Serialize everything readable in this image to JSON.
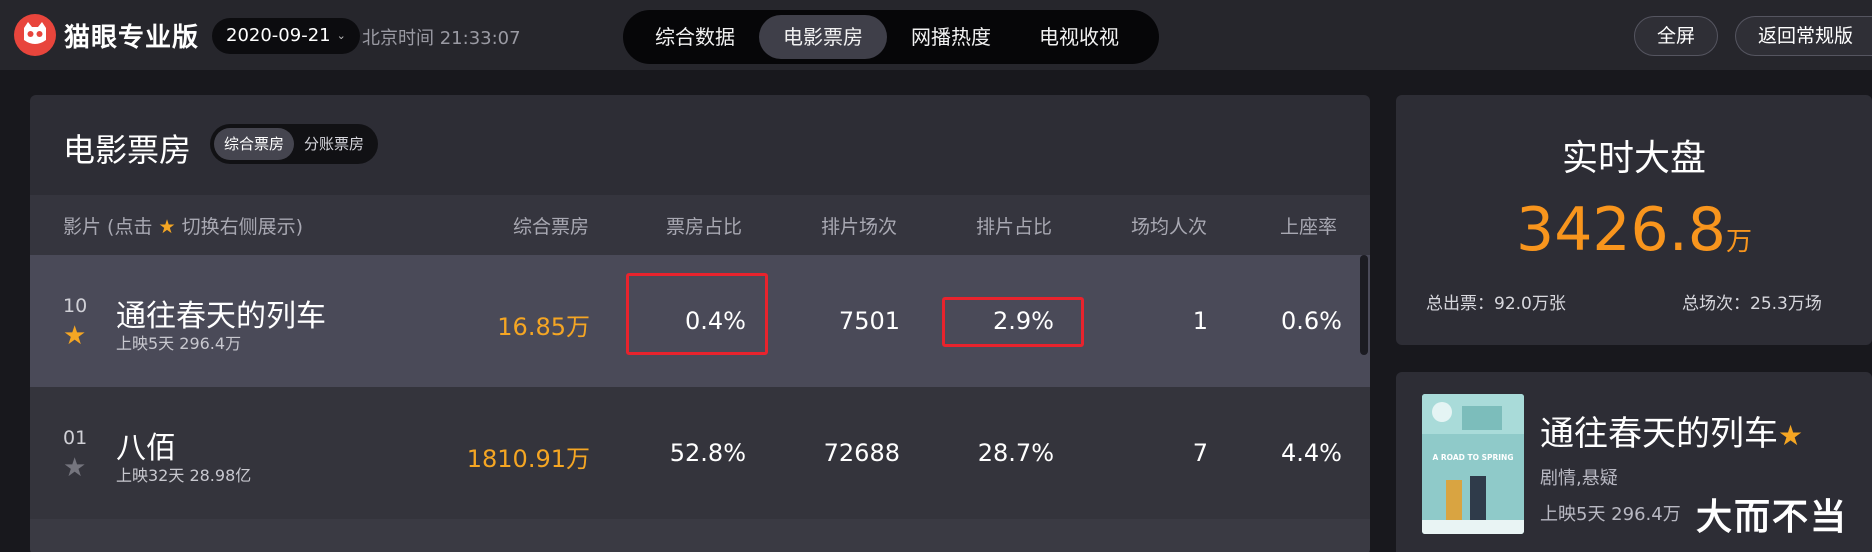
{
  "brand": {
    "name": "猫眼专业版"
  },
  "header": {
    "date": "2020-09-21",
    "time_label": "北京时间",
    "time": "21:33:07",
    "tabs": [
      "综合数据",
      "电影票房",
      "网播热度",
      "电视收视"
    ],
    "active_tab": "电影票房",
    "fullscreen_label": "全屏",
    "return_label": "返回常规版"
  },
  "boxoffice": {
    "title": "电影票房",
    "segments": [
      "综合票房",
      "分账票房"
    ],
    "active_segment": "综合票房",
    "columns": {
      "film_prefix": "影片 (点击",
      "film_suffix": "切换右侧展示)",
      "total": "综合票房",
      "share": "票房占比",
      "shows": "排片场次",
      "show_share": "排片占比",
      "avg_people": "场均人次",
      "occupancy": "上座率"
    },
    "rows": [
      {
        "rank": "10",
        "title": "通往春天的列车",
        "meta": "上映5天  296.4万",
        "total": "16.85万",
        "share": "0.4%",
        "shows": "7501",
        "show_share": "2.9%",
        "avg": "1",
        "occupancy": "0.6%",
        "starred": true
      },
      {
        "rank": "01",
        "title": "八佰",
        "meta": "上映32天  28.98亿",
        "total": "1810.91万",
        "share": "52.8%",
        "shows": "72688",
        "show_share": "28.7%",
        "avg": "7",
        "occupancy": "4.4%",
        "starred": false
      }
    ]
  },
  "realtime": {
    "title": "实时大盘",
    "value": "3426.8",
    "unit": "万",
    "tickets": "总出票：92.0万张",
    "shows": "总场次：25.3万场"
  },
  "film_card": {
    "title": "通往春天的列车",
    "genre": "剧情,悬疑",
    "meta": "上映5天  296.4万",
    "watermark": "大而不当",
    "poster_text": "A ROAD TO SPRING"
  },
  "colors": {
    "accent": "#f5a623",
    "red_mark": "#e8232d",
    "brand": "#e8453c"
  }
}
